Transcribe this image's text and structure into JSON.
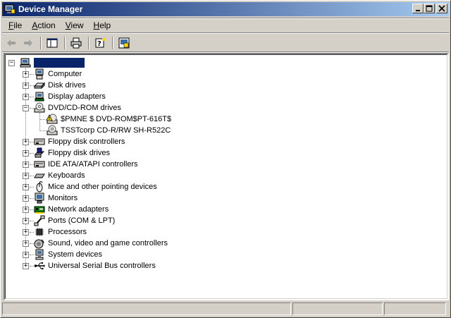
{
  "window": {
    "title": "Device Manager"
  },
  "title_buttons": {
    "minimize": "_",
    "maximize": "□",
    "close": "✕"
  },
  "menu": [
    {
      "label": "File",
      "accel": "F",
      "rest": "ile"
    },
    {
      "label": "Action",
      "accel": "A",
      "rest": "ction"
    },
    {
      "label": "View",
      "accel": "V",
      "rest": "iew"
    },
    {
      "label": "Help",
      "accel": "H",
      "rest": "elp"
    }
  ],
  "toolbar": [
    "back-arrow-icon",
    "forward-arrow-icon",
    "console-tree-icon",
    "printer-icon",
    "help-icon",
    "properties-icon"
  ],
  "tree": {
    "root_label": "",
    "categories": [
      {
        "label": "Computer",
        "icon": "computer-icon"
      },
      {
        "label": "Disk drives",
        "icon": "disk-drive-icon"
      },
      {
        "label": "Display adapters",
        "icon": "display-adapter-icon"
      },
      {
        "label": "DVD/CD-ROM drives",
        "icon": "cdrom-icon",
        "expanded": true,
        "children": [
          {
            "label": "$PMNE $ DVD-ROM$PT-616T$",
            "icon": "cdrom-warning-icon"
          },
          {
            "label": "TSSTcorp CD-R/RW SH-R522C",
            "icon": "cdrom-icon"
          }
        ]
      },
      {
        "label": "Floppy disk controllers",
        "icon": "controller-icon"
      },
      {
        "label": "Floppy disk drives",
        "icon": "floppy-icon"
      },
      {
        "label": "IDE ATA/ATAPI controllers",
        "icon": "controller-icon"
      },
      {
        "label": "Keyboards",
        "icon": "keyboard-icon"
      },
      {
        "label": "Mice and other pointing devices",
        "icon": "mouse-icon"
      },
      {
        "label": "Monitors",
        "icon": "monitor-icon"
      },
      {
        "label": "Network adapters",
        "icon": "network-adapter-icon"
      },
      {
        "label": "Ports (COM & LPT)",
        "icon": "port-icon"
      },
      {
        "label": "Processors",
        "icon": "processor-icon"
      },
      {
        "label": "Sound, video and game controllers",
        "icon": "sound-icon"
      },
      {
        "label": "System devices",
        "icon": "system-icon"
      },
      {
        "label": "Universal Serial Bus controllers",
        "icon": "usb-icon"
      }
    ]
  },
  "colors": {
    "titlebar_start": "#0a246a",
    "titlebar_end": "#a6caf0",
    "face": "#d4d0c8",
    "selection": "#0a246a"
  }
}
